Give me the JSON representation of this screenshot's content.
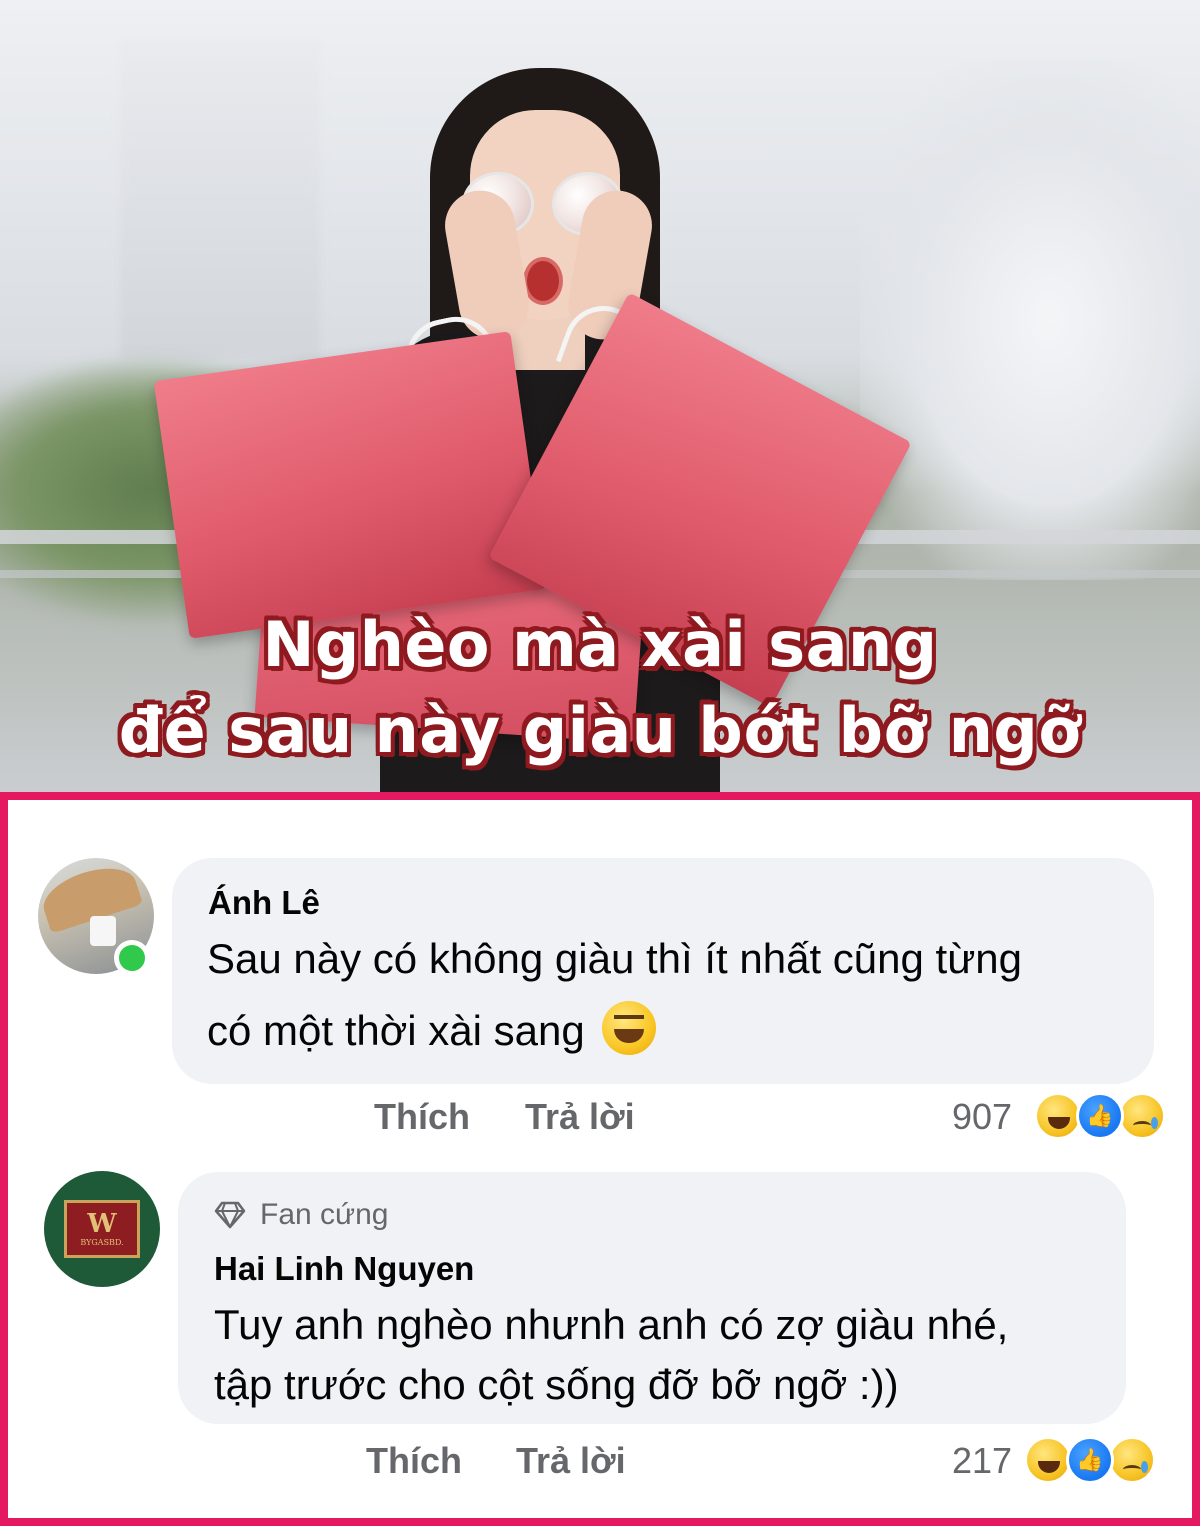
{
  "banner": {
    "caption_line1": "Nghèo mà xài sang",
    "caption_line2": "để sau này giàu bớt bỡ ngỡ"
  },
  "comments": [
    {
      "author": "Ánh Lê",
      "text_line1": "Sau này có không giàu thì ít nhất cũng từng",
      "text_line2": "có một thời xài sang",
      "inline_emoji": "grinning-squinting-face",
      "online": true,
      "like_label": "Thích",
      "reply_label": "Trả lời",
      "reaction_count": "907",
      "reactions": [
        "haha",
        "like",
        "sad"
      ]
    },
    {
      "badge": "Fan cứng",
      "author": "Hai Linh Nguyen",
      "text_line1": "Tuy anh nghèo nhưnh anh có zợ giàu nhé,",
      "text_line2": "tập trước cho cột sống đỡ bỡ ngỡ :))",
      "like_label": "Thích",
      "reply_label": "Trả lời",
      "reaction_count": "217",
      "reactions": [
        "haha",
        "like",
        "sad"
      ]
    }
  ],
  "colors": {
    "frame_border": "#e5195f",
    "caption_outline": "#8e1a1f",
    "bubble_bg": "#f0f2f5",
    "secondary_text": "#65676b",
    "online_green": "#31c94b",
    "like_blue": "#1877f2"
  }
}
